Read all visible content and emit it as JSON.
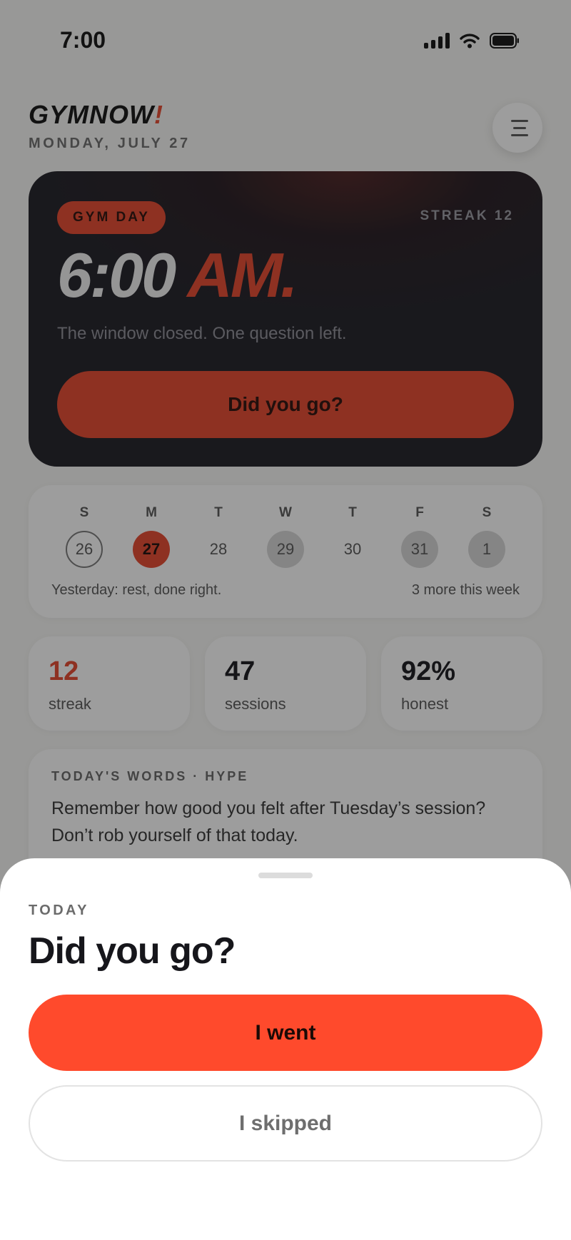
{
  "status_bar": {
    "time": "7:00"
  },
  "header": {
    "brand_main": "GYMNOW",
    "brand_bang": "!",
    "date": "MONDAY, JULY 27"
  },
  "hero": {
    "pill": "GYM DAY",
    "streak_label": "STREAK 12",
    "time": "6:00",
    "ampm": "AM.",
    "subtitle": "The window closed. One question left.",
    "button": "Did you go?"
  },
  "calendar": {
    "weekdays": [
      "S",
      "M",
      "T",
      "W",
      "T",
      "F",
      "S"
    ],
    "days": [
      {
        "num": "26",
        "state": "past"
      },
      {
        "num": "27",
        "state": "today"
      },
      {
        "num": "28",
        "state": "rest"
      },
      {
        "num": "29",
        "state": "gym"
      },
      {
        "num": "30",
        "state": "rest"
      },
      {
        "num": "31",
        "state": "gym"
      },
      {
        "num": "1",
        "state": "gym"
      }
    ],
    "footer_left": "Yesterday: rest, done right.",
    "footer_right": "3 more this week"
  },
  "stats": [
    {
      "value": "12",
      "label": "streak"
    },
    {
      "value": "47",
      "label": "sessions"
    },
    {
      "value": "92%",
      "label": "honest"
    }
  ],
  "words": {
    "tag": "TODAY'S WORDS · HYPE",
    "text": "Remember how good you felt after Tuesday’s session? Don’t rob yourself of that today."
  },
  "sheet": {
    "tag": "TODAY",
    "title": "Did you go?",
    "primary": "I went",
    "secondary": "I skipped"
  },
  "colors": {
    "accent": "#e5452c",
    "primary_button": "#ff4a2c",
    "card_dark": "#1d1c24",
    "scrim": "rgba(22,22,22,0.42)"
  }
}
